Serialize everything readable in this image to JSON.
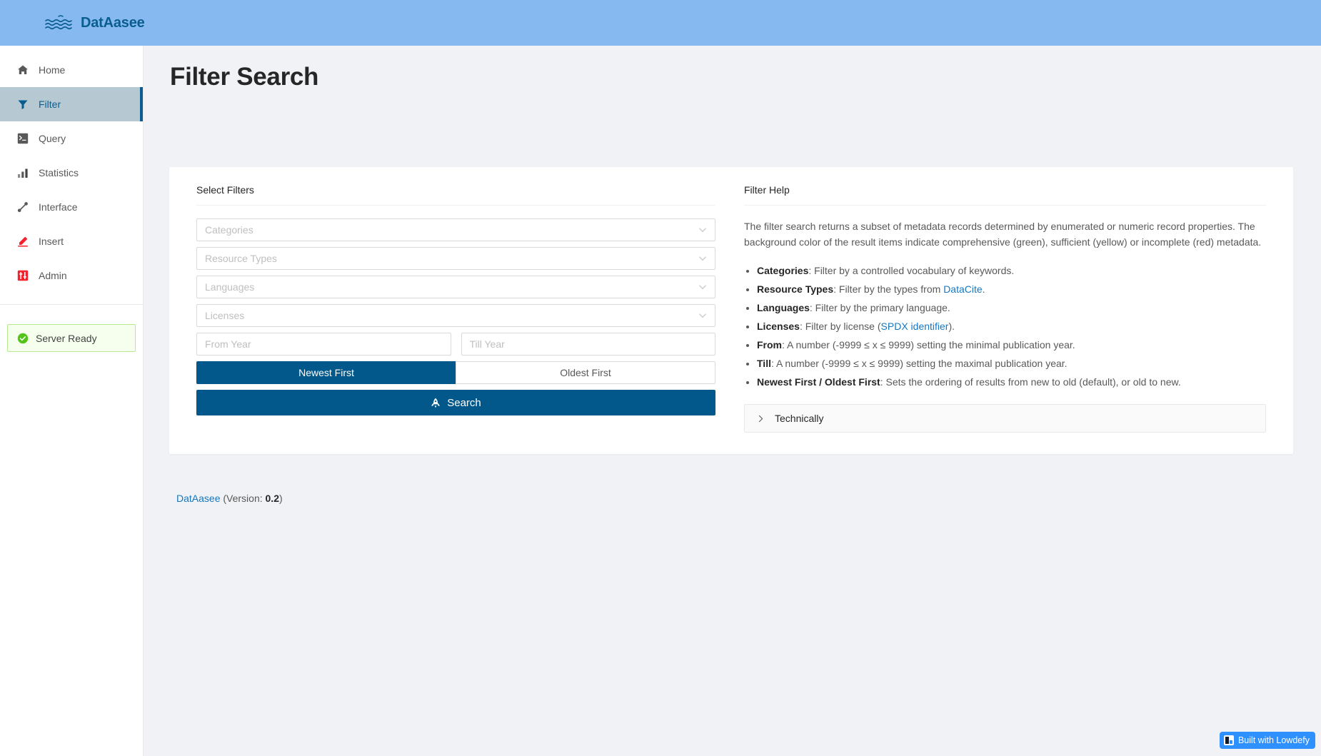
{
  "brand": {
    "name": "DatAasee",
    "logo_icon": "waves-icon"
  },
  "sidebar": {
    "items": [
      {
        "label": "Home",
        "icon": "home-icon",
        "active": false
      },
      {
        "label": "Filter",
        "icon": "funnel-icon",
        "active": true
      },
      {
        "label": "Query",
        "icon": "console-icon",
        "active": false
      },
      {
        "label": "Statistics",
        "icon": "bar-chart-icon",
        "active": false
      },
      {
        "label": "Interface",
        "icon": "api-icon",
        "active": false
      },
      {
        "label": "Insert",
        "icon": "pencil-icon",
        "active": false
      },
      {
        "label": "Admin",
        "icon": "sliders-icon",
        "active": false
      }
    ],
    "status": {
      "label": "Server Ready",
      "icon": "check-circle-icon",
      "color": "#52c41a"
    }
  },
  "page": {
    "title": "Filter Search"
  },
  "filters": {
    "panel_title": "Select Filters",
    "selects": [
      {
        "name": "categories",
        "placeholder": "Categories",
        "value": ""
      },
      {
        "name": "resource-types",
        "placeholder": "Resource Types",
        "value": ""
      },
      {
        "name": "languages",
        "placeholder": "Languages",
        "value": ""
      },
      {
        "name": "licenses",
        "placeholder": "Licenses",
        "value": ""
      }
    ],
    "from_year": {
      "placeholder": "From Year",
      "value": ""
    },
    "till_year": {
      "placeholder": "Till Year",
      "value": ""
    },
    "sort": {
      "newest_label": "Newest First",
      "oldest_label": "Oldest First",
      "selected": "Newest First"
    },
    "search_label": "Search",
    "search_icon": "rocket-icon"
  },
  "help": {
    "panel_title": "Filter Help",
    "intro": "The filter search returns a subset of metadata records determined by enumerated or numeric record properties. The background color of the result items indicate comprehensive (green), sufficient (yellow) or incomplete (red) metadata.",
    "items": [
      {
        "term": "Categories",
        "text": ": Filter by a controlled vocabulary of keywords."
      },
      {
        "term": "Resource Types",
        "text": ": Filter by the types from ",
        "link": "DataCite",
        "after": "."
      },
      {
        "term": "Languages",
        "text": ": Filter by the primary language."
      },
      {
        "term": "Licenses",
        "text": ": Filter by license (",
        "link": "SPDX identifier",
        "after": ")."
      },
      {
        "term": "From",
        "text": ": A number (-9999 ≤ x ≤ 9999) setting the minimal publication year."
      },
      {
        "term": "Till",
        "text": ": A number (-9999 ≤ x ≤ 9999) setting the maximal publication year."
      },
      {
        "term": "Newest First / Oldest First",
        "text": ": Sets the ordering of results from new to old (default), or old to new."
      }
    ],
    "accordion": {
      "label": "Technically",
      "icon": "chevron-right-icon",
      "expanded": false
    }
  },
  "footer": {
    "link": "DatAasee",
    "version_prefix": " (Version: ",
    "version": "0.2",
    "version_suffix": ")"
  },
  "lowdefy_badge": {
    "label": "Built with Lowdefy",
    "icon": "lowdefy-logo-icon",
    "color": "#2f90ff"
  }
}
